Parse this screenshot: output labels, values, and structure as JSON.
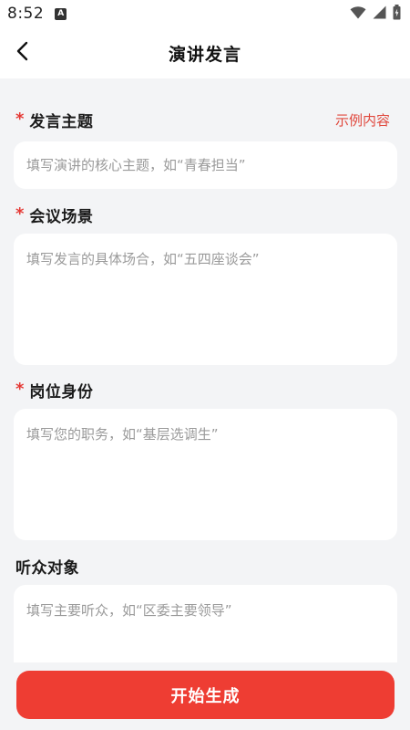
{
  "status_bar": {
    "time": "8:52",
    "notification_badge": "A",
    "icons": [
      "wifi-icon",
      "signal-icon",
      "battery-icon"
    ]
  },
  "header": {
    "title": "演讲发言",
    "back_icon": "chevron-left-icon"
  },
  "fields": [
    {
      "label": "发言主题",
      "required": true,
      "placeholder": "填写演讲的核心主题，如“青春担当”",
      "value": ""
    },
    {
      "label": "会议场景",
      "required": true,
      "placeholder": "填写发言的具体场合，如“五四座谈会”",
      "value": ""
    },
    {
      "label": "岗位身份",
      "required": true,
      "placeholder": "填写您的职务，如“基层选调生”",
      "value": ""
    },
    {
      "label": "听众对象",
      "required": false,
      "placeholder": "填写主要听众，如“区委主要领导”",
      "value": ""
    }
  ],
  "required_mark": "*",
  "example_link": "示例内容",
  "submit_button": "开始生成",
  "colors": {
    "accent": "#ee3d33",
    "required": "#e53935",
    "example_link": "#e0483d",
    "background": "#f3f4f6",
    "card": "#ffffff"
  }
}
